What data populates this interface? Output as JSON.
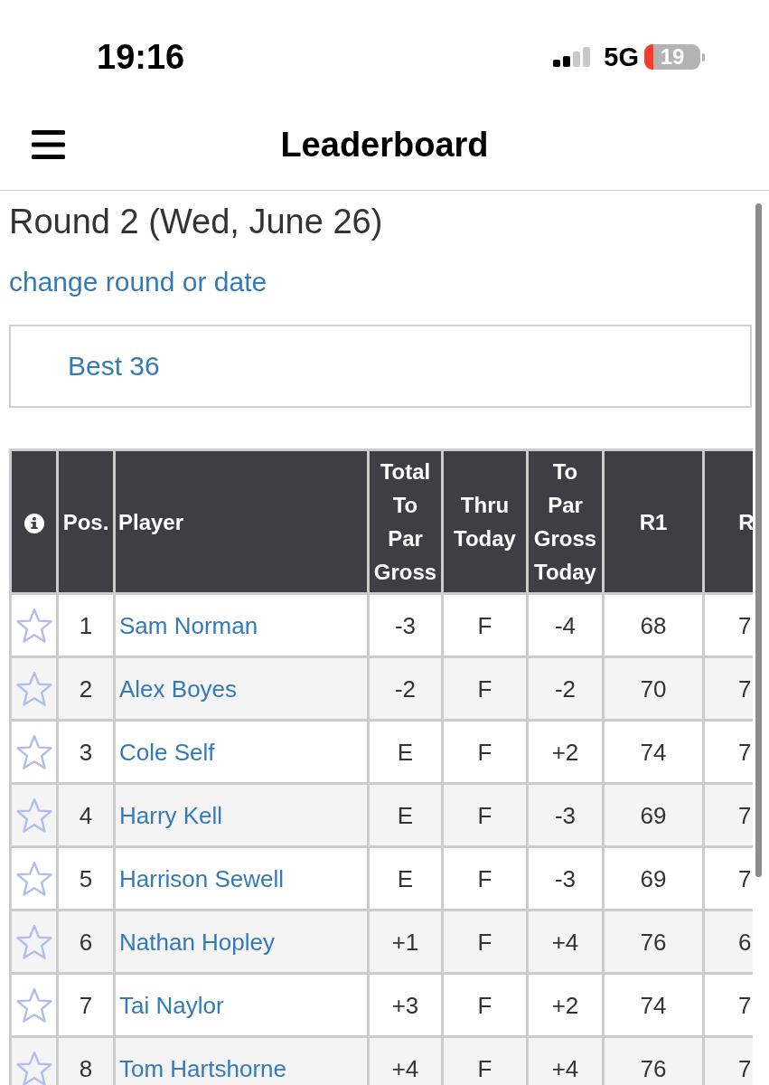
{
  "status_bar": {
    "time": "19:16",
    "network": "5G",
    "battery": "19"
  },
  "header": {
    "title": "Leaderboard"
  },
  "round": {
    "title": "Round 2 (Wed, June 26)",
    "link": "change round or date"
  },
  "filter": {
    "label": "Best 36"
  },
  "table": {
    "columns": [
      {
        "kind": "icon"
      },
      {
        "kind": "number",
        "label": "Pos."
      },
      {
        "kind": "player",
        "label": "Player"
      },
      {
        "kind": "number",
        "label": "Total To Par Gross"
      },
      {
        "kind": "number",
        "label": "Thru Today"
      },
      {
        "kind": "number",
        "label": "To Par Gross Today"
      },
      {
        "kind": "number",
        "label": "R1"
      },
      {
        "kind": "clipped",
        "label": "R"
      }
    ],
    "rows": [
      {
        "favorite": false,
        "cells": [
          "",
          "1",
          "Sam Norman",
          "-3",
          "F",
          "-4",
          "68",
          "7"
        ]
      },
      {
        "favorite": false,
        "cells": [
          "",
          "2",
          "Alex Boyes",
          "-2",
          "F",
          "-2",
          "70",
          "7"
        ]
      },
      {
        "favorite": false,
        "cells": [
          "",
          "3",
          "Cole Self",
          "E",
          "F",
          "+2",
          "74",
          "7"
        ]
      },
      {
        "favorite": false,
        "cells": [
          "",
          "4",
          "Harry Kell",
          "E",
          "F",
          "-3",
          "69",
          "7"
        ]
      },
      {
        "favorite": false,
        "cells": [
          "",
          "5",
          "Harrison Sewell",
          "E",
          "F",
          "-3",
          "69",
          "7"
        ]
      },
      {
        "favorite": false,
        "cells": [
          "",
          "6",
          "Nathan Hopley",
          "+1",
          "F",
          "+4",
          "76",
          "6"
        ]
      },
      {
        "favorite": false,
        "cells": [
          "",
          "7",
          "Tai Naylor",
          "+3",
          "F",
          "+2",
          "74",
          "7"
        ]
      },
      {
        "favorite": false,
        "cells": [
          "",
          "8",
          "Tom Hartshorne",
          "+4",
          "F",
          "+4",
          "76",
          "7"
        ]
      }
    ]
  }
}
